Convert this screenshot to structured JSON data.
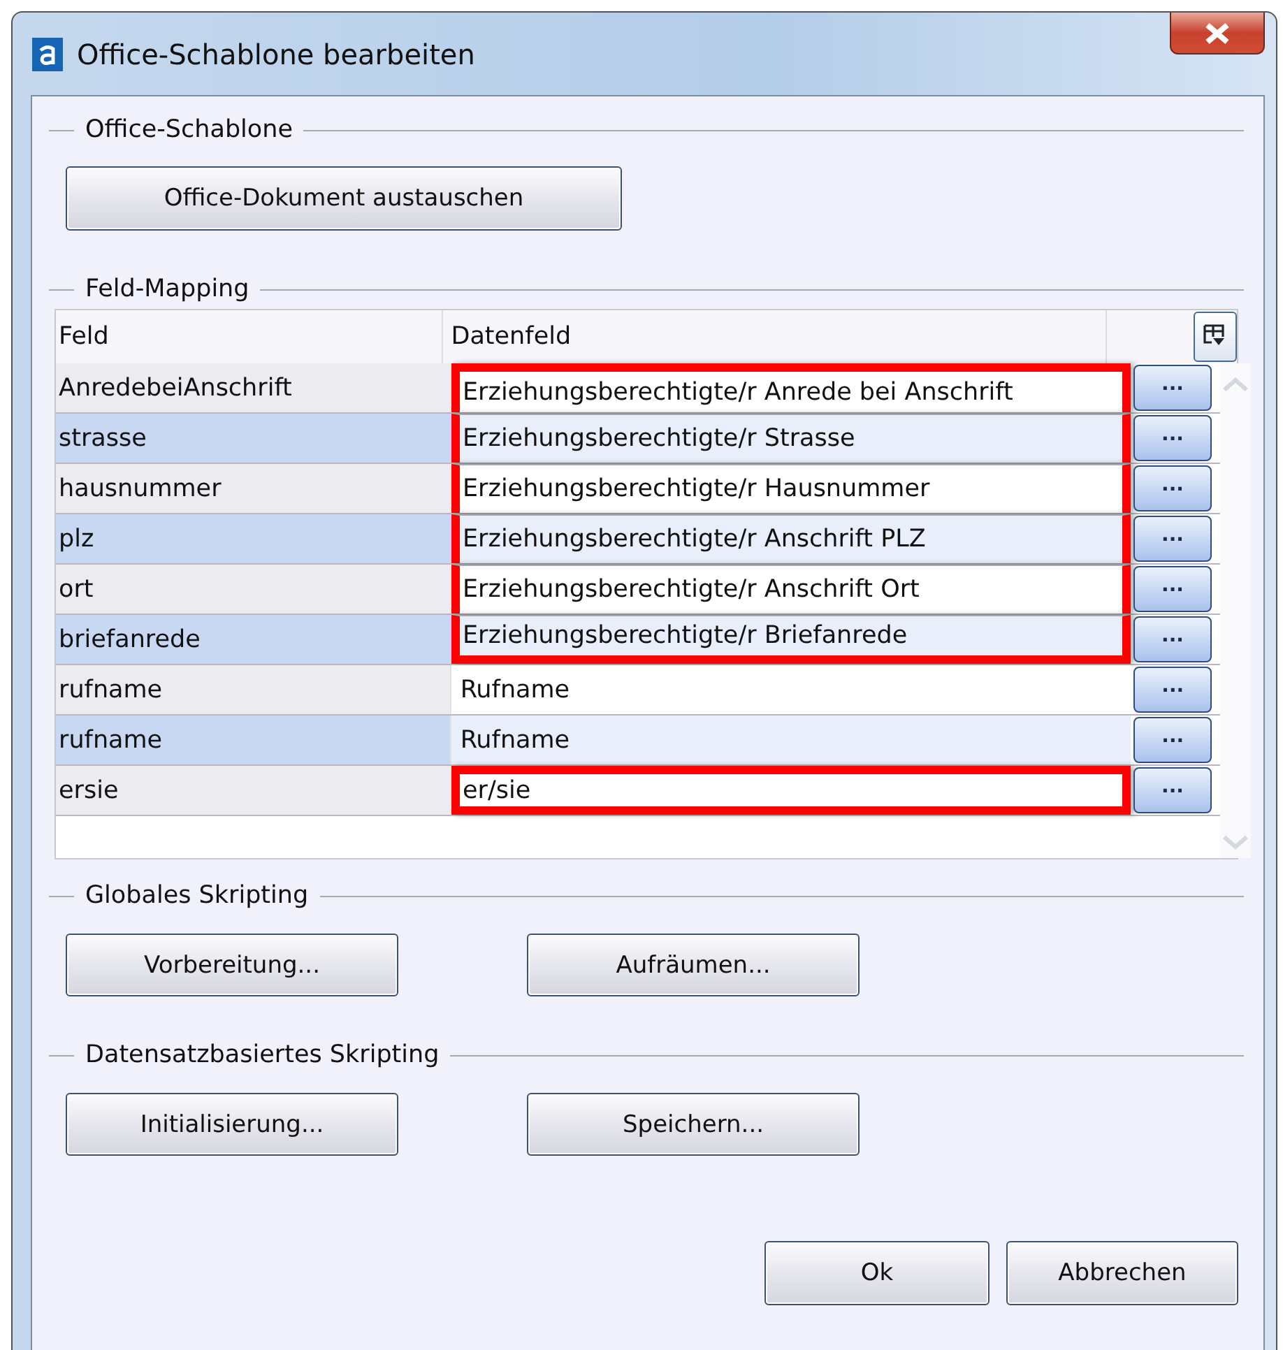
{
  "window": {
    "title": "Office-Schablone bearbeiten"
  },
  "office_template": {
    "heading": "Office-Schablone",
    "button": "Office-Dokument austauschen"
  },
  "field_mapping": {
    "heading": "Feld-Mapping",
    "columns": [
      "Feld",
      "Datenfeld"
    ],
    "rows": [
      {
        "field": "AnredebeiAnschrift",
        "data_field": "Erziehungsberechtigte/r Anrede bei Anschrift",
        "button": "...",
        "highlighted": true
      },
      {
        "field": "strasse",
        "data_field": "Erziehungsberechtigte/r Strasse",
        "button": "...",
        "highlighted": true
      },
      {
        "field": "hausnummer",
        "data_field": "Erziehungsberechtigte/r Hausnummer",
        "button": "...",
        "highlighted": true
      },
      {
        "field": "plz",
        "data_field": "Erziehungsberechtigte/r Anschrift PLZ",
        "button": "...",
        "highlighted": true
      },
      {
        "field": "ort",
        "data_field": "Erziehungsberechtigte/r Anschrift Ort",
        "button": "...",
        "highlighted": true
      },
      {
        "field": "briefanrede",
        "data_field": "Erziehungsberechtigte/r Briefanrede",
        "button": "...",
        "highlighted": true
      },
      {
        "field": "rufname",
        "data_field": "Rufname",
        "button": "...",
        "highlighted": false
      },
      {
        "field": "rufname",
        "data_field": "Rufname",
        "button": "...",
        "highlighted": false
      },
      {
        "field": "ersie",
        "data_field": "er/sie",
        "button": "...",
        "highlighted": true
      }
    ]
  },
  "global_scripting": {
    "heading": "Globales Skripting",
    "buttons": [
      "Vorbereitung...",
      "Aufräumen..."
    ]
  },
  "record_scripting": {
    "heading": "Datensatzbasiertes Skripting",
    "buttons": [
      "Initialisierung...",
      "Speichern..."
    ]
  },
  "buttons": [
    "Ok",
    "Abbrechen"
  ]
}
